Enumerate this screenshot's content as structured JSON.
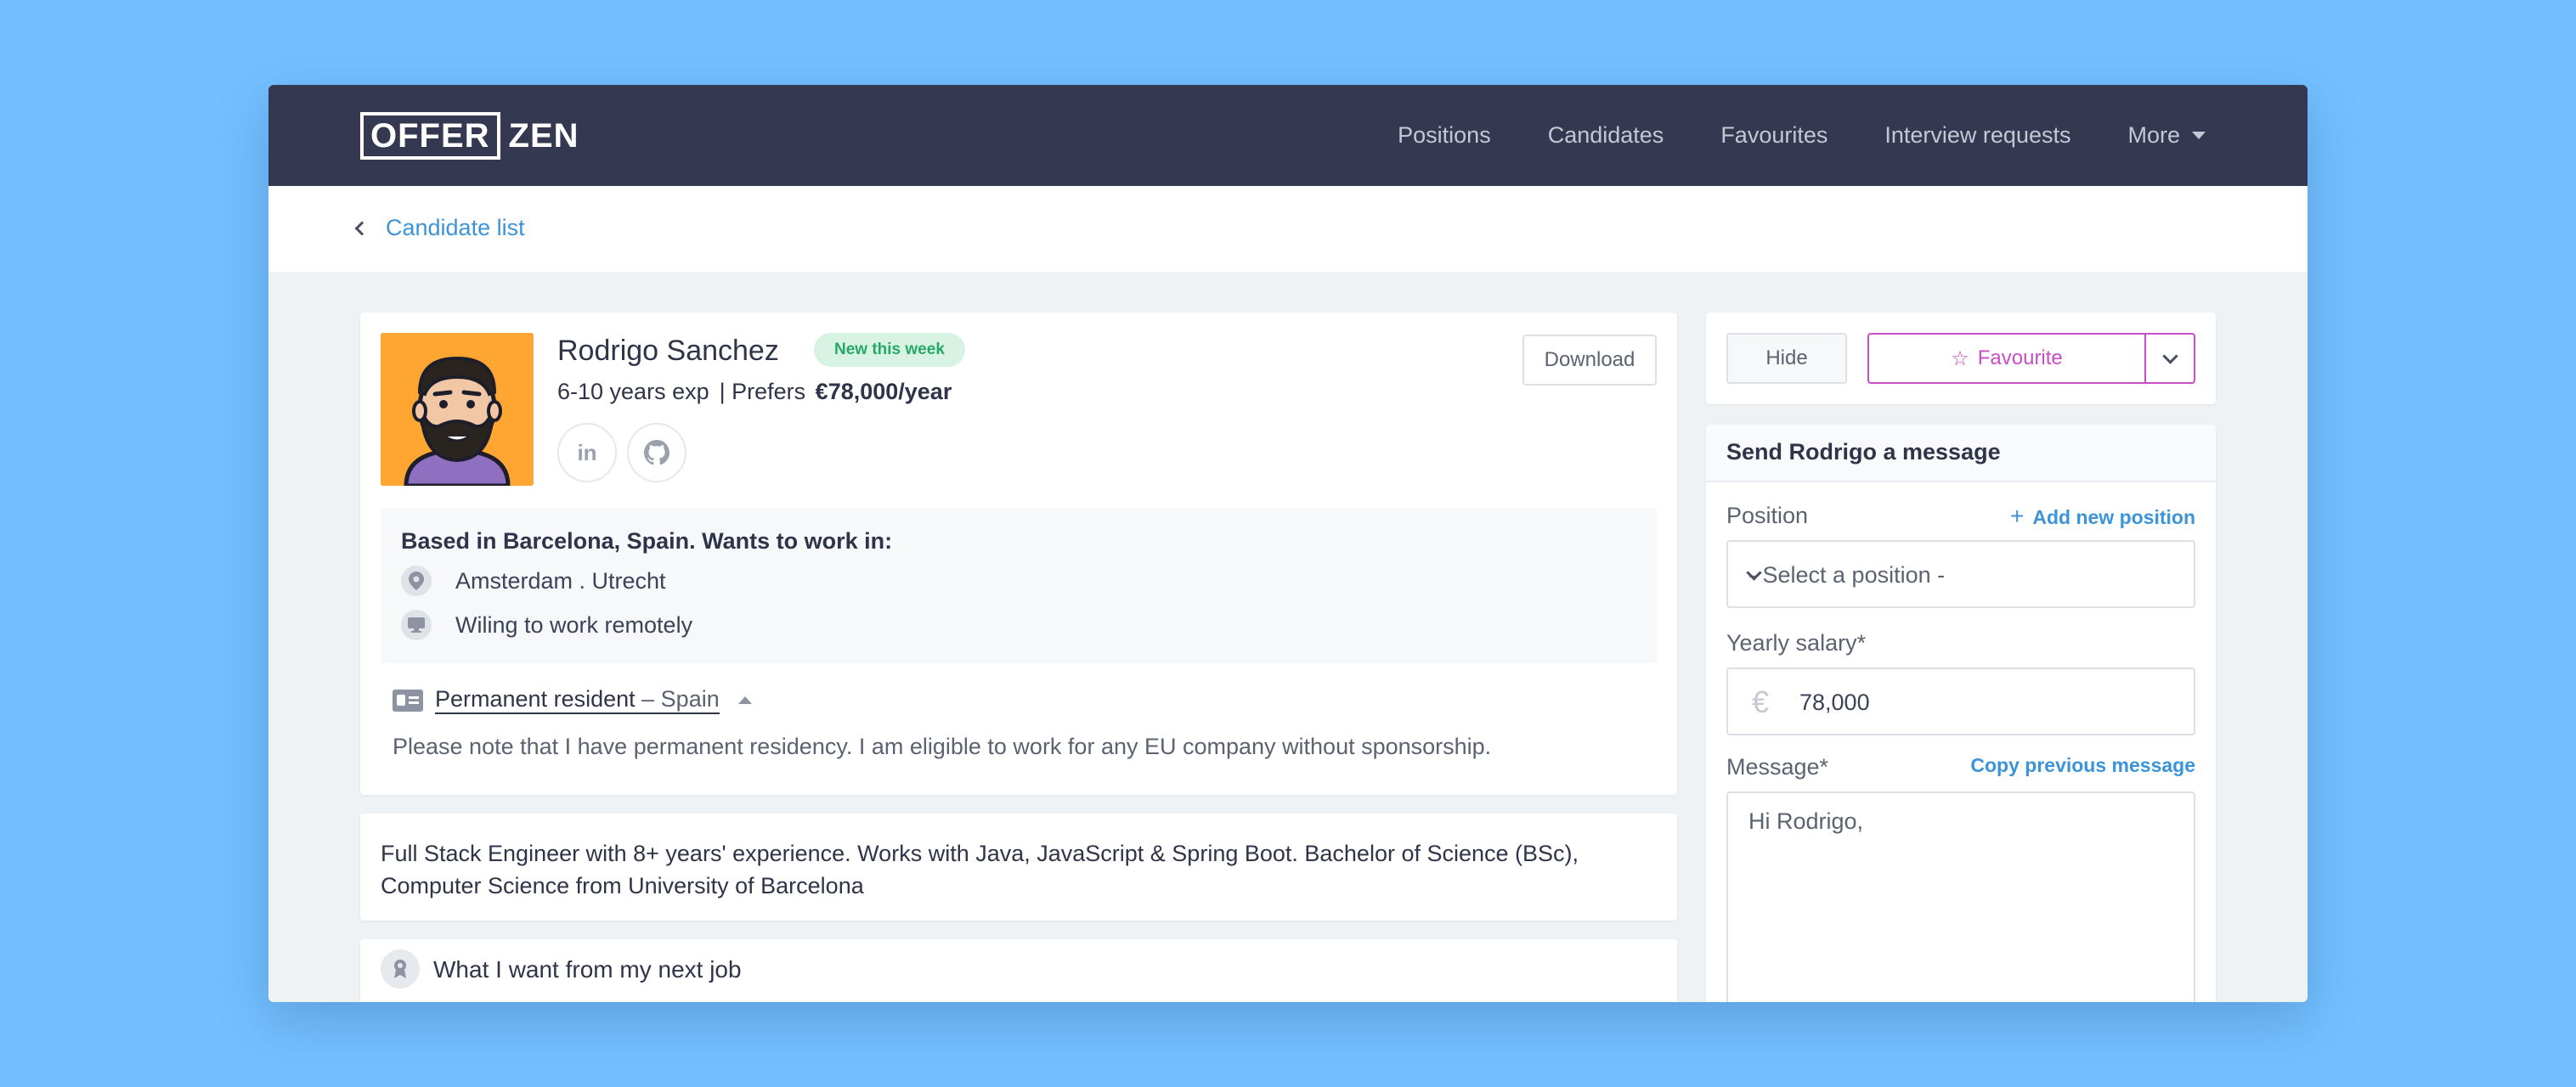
{
  "nav": {
    "logo_box": "OFFER",
    "logo_rest": "ZEN",
    "links": [
      "Positions",
      "Candidates",
      "Favourites",
      "Interview requests"
    ],
    "more": "More"
  },
  "breadcrumb": {
    "label": "Candidate list"
  },
  "profile": {
    "name": "Rodrigo Sanchez",
    "badge": "New this week",
    "experience": "6-10 years exp",
    "prefers_prefix": "| Prefers",
    "salary_pref": "€78,000/year",
    "social": {
      "linkedin": "in"
    },
    "download": "Download",
    "location": {
      "heading": "Based in Barcelona, Spain. Wants to work in:",
      "cities": "Amsterdam . Utrecht",
      "remote": "Wiling to work remotely"
    },
    "residency": {
      "status": "Permanent resident",
      "dash": " – ",
      "country": "Spain",
      "note": "Please note that I have permanent residency. I am eligible to work for any EU company without sponsorship."
    }
  },
  "summary": "Full Stack Engineer with 8+ years' experience. Works with Java, JavaScript & Spring Boot. Bachelor of Science (BSc), Computer Science from University of Barcelona",
  "next_job": {
    "title": "What I want from my next job"
  },
  "actions": {
    "hide": "Hide",
    "favourite": "Favourite"
  },
  "message": {
    "title": "Send Rodrigo a message",
    "position_label": "Position",
    "add_position": "Add new position",
    "position_placeholder": "- Select a position -",
    "salary_label": "Yearly salary*",
    "salary_currency": "€",
    "salary_value": "78,000",
    "message_label": "Message*",
    "copy_previous": "Copy previous message",
    "message_value": "Hi Rodrigo,"
  },
  "colors": {
    "background": "#73bfff",
    "nav": "#353851",
    "accent_link": "#3b94d9",
    "favourite": "#c84ec7",
    "badge_bg": "#d8f2e4",
    "badge_text": "#27a866",
    "avatar_bg": "#ffa532"
  },
  "icons": [
    "chevron-left-icon",
    "caret-down-icon",
    "linkedin-icon",
    "github-icon",
    "location-pin-icon",
    "monitor-icon",
    "id-card-icon",
    "caret-up-icon",
    "award-icon",
    "star-icon",
    "chevron-down-icon",
    "plus-icon"
  ]
}
